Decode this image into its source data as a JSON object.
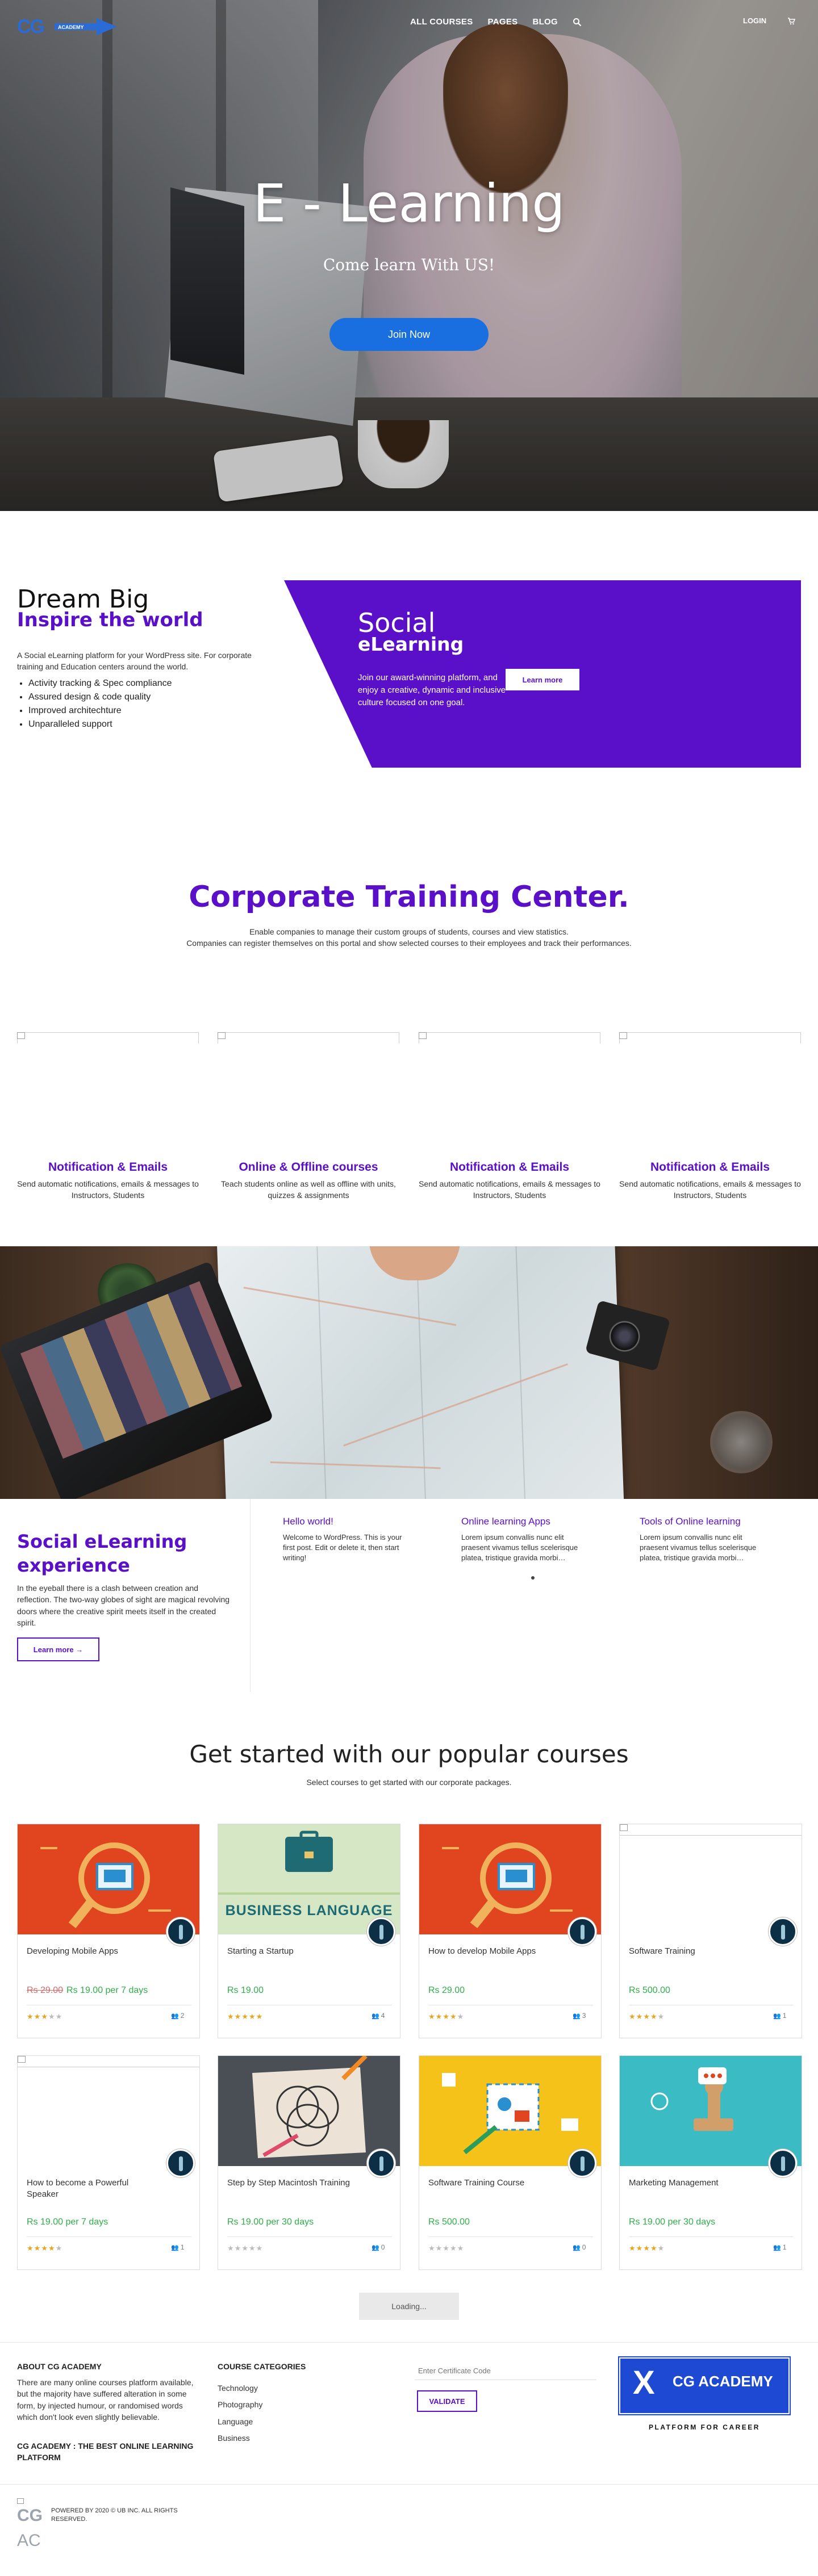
{
  "nav": {
    "logo_text": "CG",
    "logo_subtext": "ACADEMY",
    "menu": [
      "ALL COURSES",
      "PAGES",
      "BLOG"
    ],
    "login": "LOGIN"
  },
  "hero": {
    "title": "E - Learning",
    "subtitle": "Come learn With US!",
    "cta": "Join Now"
  },
  "intro": {
    "title": "Dream Big",
    "subtitle": "Inspire the world",
    "text": "A Social eLearning platform for your WordPress site. For corporate training and Education centers around the world.",
    "list": [
      "Activity tracking & Spec compliance",
      "Assured design & code quality",
      "Improved architechture",
      "Unparalleled support"
    ]
  },
  "promo": {
    "title": "Social",
    "subtitle": "eLearning",
    "text": "Join our award-winning platform, and enjoy a creative, dynamic and inclusive culture focused on one goal.",
    "button": "Learn more"
  },
  "corporate": {
    "title": "Corporate Training Center.",
    "text1": "Enable companies to manage their custom groups of students, courses and view statistics.",
    "text2": "Companies can register themselves on this portal and show selected courses to their employees and track their performances.",
    "features": [
      {
        "title": "Notification & Emails",
        "text": "Send automatic notifications, emails & messages to Instructors, Students"
      },
      {
        "title": "Online & Offline courses",
        "text": "Teach students online as well as offline with units, quizzes & assignments"
      },
      {
        "title": "Notification & Emails",
        "text": "Send automatic notifications, emails & messages to Instructors, Students"
      },
      {
        "title": "Notification & Emails",
        "text": "Send automatic notifications, emails & messages to Instructors, Students"
      }
    ]
  },
  "social": {
    "title": "Social eLearning experience",
    "text": "In the eyeball there is a clash between creation and reflection. The two-way globes of sight are magical revolving doors where the creative spirit meets itself in the created spirit.",
    "button": "Learn more →",
    "posts": [
      {
        "title": "Hello world!",
        "text": "Welcome to WordPress. This is your first post. Edit or delete it, then start writing!"
      },
      {
        "title": "Online learning Apps",
        "text": "Lorem ipsum convallis nunc elit praesent vivamus tellus scelerisque platea, tristique gravida morbi…"
      },
      {
        "title": "Tools of Online learning",
        "text": "Lorem ipsum convallis nunc elit praesent vivamus tellus scelerisque platea, tristique gravida morbi…"
      }
    ]
  },
  "courses": {
    "title": "Get started with our popular courses",
    "subtitle": "Select courses to get started with our corporate packages.",
    "items": [
      {
        "name": "Developing Mobile Apps",
        "old_price": "Rs 29.00",
        "price": "Rs 19.00 per 7 days",
        "rating": 3,
        "students": "2",
        "thumb": "search-red",
        "thumb_text": ""
      },
      {
        "name": "Starting a Startup",
        "old_price": "",
        "price": "Rs 19.00",
        "rating": 5,
        "students": "4",
        "thumb": "business",
        "thumb_text": "BUSINESS LANGUAGE"
      },
      {
        "name": "How to develop Mobile Apps",
        "old_price": "",
        "price": "Rs 29.00",
        "rating": 4,
        "students": "3",
        "thumb": "search-red",
        "thumb_text": ""
      },
      {
        "name": "Software Training",
        "old_price": "",
        "price": "Rs 500.00",
        "rating": 4,
        "students": "1",
        "thumb": "blank",
        "thumb_text": ""
      },
      {
        "name": "How to become a Powerful Speaker",
        "old_price": "",
        "price": "Rs 19.00 per 7 days",
        "rating": 4,
        "students": "1",
        "thumb": "blank",
        "thumb_text": ""
      },
      {
        "name": "Step by Step Macintosh Training",
        "old_price": "",
        "price": "Rs 19.00 per 30 days",
        "rating": 0,
        "students": "0",
        "thumb": "venn",
        "thumb_text": ""
      },
      {
        "name": "Software Training Course",
        "old_price": "",
        "price": "Rs 500.00",
        "rating": 0,
        "students": "0",
        "thumb": "yellow",
        "thumb_text": ""
      },
      {
        "name": "Marketing Management",
        "old_price": "",
        "price": "Rs 19.00 per 30 days",
        "rating": 4,
        "students": "1",
        "thumb": "teal",
        "thumb_text": ""
      }
    ],
    "loading": "Loading..."
  },
  "footer": {
    "about_title": "ABOUT CG ACADEMY",
    "about_text": "There are many online courses platform available, but the majority have suffered alteration in some form, by injected humour, or randomised words which don't look even slightly believable.",
    "about_tag": "CG ACADEMY : THE BEST ONLINE LEARNING PLATFORM",
    "cat_title": "COURSE CATEGORIES",
    "categories": [
      "Technology",
      "Photography",
      "Language",
      "Business"
    ],
    "cert_placeholder": "Enter Certificate Code",
    "validate": "VALIDATE",
    "logo_x": "X",
    "logo_name": "CG ACADEMY",
    "logo_tag": "PLATFORM FOR CAREER",
    "bottom_logo1": "CG",
    "bottom_logo2": "AC",
    "copyright": "POWERED BY 2020 © UB INC. ALL RIGHTS RESERVED."
  },
  "colors": {
    "accent": "#5a0fc8",
    "blue": "#1a6fe0",
    "price": "#2fae49",
    "star": "#e7a520"
  }
}
